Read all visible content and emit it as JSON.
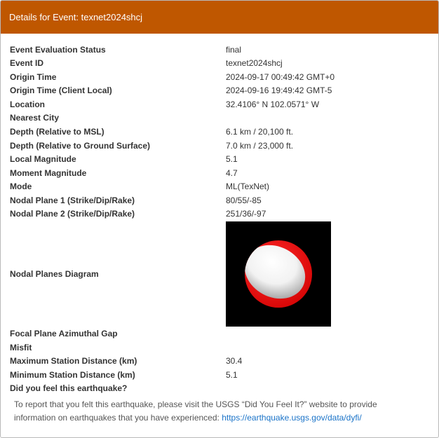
{
  "dialog": {
    "title": "Details for Event: texnet2024shcj"
  },
  "details": [
    {
      "label": "Event Evaluation Status",
      "value": "final"
    },
    {
      "label": "Event ID",
      "value": "texnet2024shcj"
    },
    {
      "label": "Origin Time",
      "value": "2024-09-17 00:49:42 GMT+0"
    },
    {
      "label": "Origin Time (Client Local)",
      "value": "2024-09-16 19:49:42 GMT-5"
    },
    {
      "label": "Location",
      "value": "32.4106° N 102.0571° W"
    },
    {
      "label": "Nearest City",
      "value": ""
    },
    {
      "label": "Depth (Relative to MSL)",
      "value": "6.1 km / 20,100 ft."
    },
    {
      "label": "Depth (Relative to Ground Surface)",
      "value": "7.0 km / 23,000 ft."
    },
    {
      "label": "Local Magnitude",
      "value": "5.1"
    },
    {
      "label": "Moment Magnitude",
      "value": "4.7"
    },
    {
      "label": "Mode",
      "value": "ML(TexNet)"
    },
    {
      "label": "Nodal Plane 1 (Strike/Dip/Rake)",
      "value": "80/55/-85"
    },
    {
      "label": "Nodal Plane 2 (Strike/Dip/Rake)",
      "value": "251/36/-97"
    },
    {
      "label": "Nodal Planes Diagram",
      "value": ""
    },
    {
      "label": "Focal Plane Azimuthal Gap",
      "value": ""
    },
    {
      "label": "Misfit",
      "value": ""
    },
    {
      "label": "Maximum Station Distance (km)",
      "value": "30.4"
    },
    {
      "label": "Minimum Station Distance (km)",
      "value": "5.1"
    },
    {
      "label": "Did you feel this earthquake?",
      "value": ""
    }
  ],
  "footer": {
    "text": "To report that you felt this earthquake, please visit the USGS “Did You Feel It?” website to provide information on earthquakes that you have experienced: ",
    "link_text": "https://earthquake.usgs.gov/data/dyfi/"
  },
  "colors": {
    "titlebar": "#bf5700",
    "beachball_compression": "#ff0000",
    "beachball_dilatation": "#ffffff",
    "link": "#1a73c8"
  }
}
